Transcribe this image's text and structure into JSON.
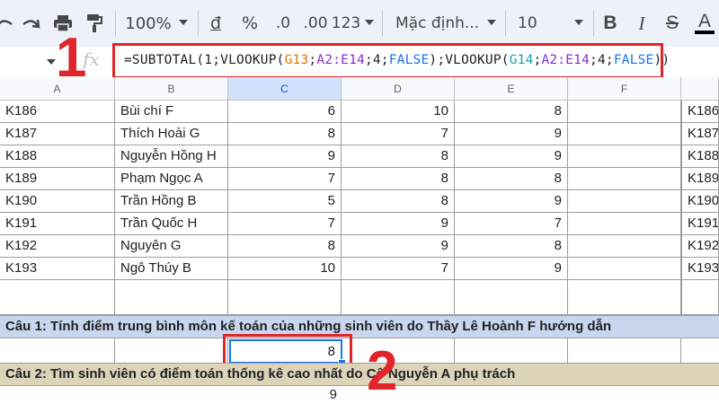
{
  "toolbar": {
    "zoom": "100%",
    "currency_symbol": "đ",
    "percent_symbol": "%",
    "decrease_decimal": ".0",
    "increase_decimal": ".00",
    "more_formats": "123",
    "font_name": "Mặc định...",
    "font_size": "10",
    "bold_label": "B",
    "italic_label": "I",
    "strike_label": "S",
    "text_color_label": "A"
  },
  "formula_bar": {
    "fx_label": "fx",
    "formula_parts": [
      "=SUBTOTAL(1;VLOOKUP(",
      "G13",
      ";",
      "A2:E14",
      ";4;",
      "FALSE",
      ");VLOOKUP(",
      "G14",
      ";",
      "A2:E14",
      ";4;",
      "FALSE",
      "))"
    ]
  },
  "columns": [
    "A",
    "B",
    "C",
    "D",
    "E",
    "F"
  ],
  "rows": [
    {
      "id": "K186",
      "name": "Bùi chí F",
      "c": "6",
      "d": "10",
      "e": "8",
      "g": "K186"
    },
    {
      "id": "K187",
      "name": "Thích Hoài G",
      "c": "8",
      "d": "7",
      "e": "9",
      "g": "K187"
    },
    {
      "id": "K188",
      "name": "Nguyễn Hồng H",
      "c": "9",
      "d": "8",
      "e": "9",
      "g": "K188"
    },
    {
      "id": "K189",
      "name": "Phạm Ngọc A",
      "c": "7",
      "d": "8",
      "e": "8",
      "g": "K189"
    },
    {
      "id": "K190",
      "name": "Trần Hồng B",
      "c": "5",
      "d": "8",
      "e": "9",
      "g": "K190"
    },
    {
      "id": "K191",
      "name": "Trần Quốc H",
      "c": "7",
      "d": "9",
      "e": "7",
      "g": "K191"
    },
    {
      "id": "K192",
      "name": "Nguyên G",
      "c": "8",
      "d": "9",
      "e": "8",
      "g": "K192"
    },
    {
      "id": "K193",
      "name": "Ngô Thúy B",
      "c": "10",
      "d": "7",
      "e": "9",
      "g": "K193"
    }
  ],
  "question1": "Câu 1: Tính điểm trung bình môn kế toán của những sinh viên do Thầy Lê Hoành F hướng dẫn",
  "result_value": "8",
  "question2": "Câu 2: Tìm sinh viên có điểm toán thống kê cao nhất do Cô Nguyễn A phụ trách",
  "bottom_value": "9",
  "step_markers": [
    "1",
    "2"
  ],
  "colors": {
    "annotation_red": "#e0262b",
    "selection_blue": "#1a73e8",
    "question1_bg": "#c9d7ee",
    "question2_bg": "#ddd3b8"
  }
}
